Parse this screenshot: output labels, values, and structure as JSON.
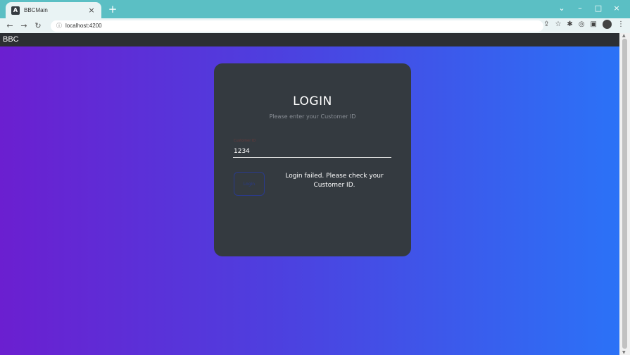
{
  "browser": {
    "tab_title": "BBCMain",
    "tab_close": "×",
    "new_tab": "+",
    "url": "localhost:4200",
    "win_minimize": "–",
    "win_maximize": "□",
    "win_close": "×",
    "chevron": "⌄"
  },
  "app": {
    "brand": "BBC"
  },
  "login": {
    "title": "LOGIN",
    "subtitle": "Please enter your Customer ID",
    "field_label": "Customer ID",
    "field_value": "1234",
    "button_label": "Login",
    "error_message": "Login failed. Please check your Customer ID."
  },
  "colors": {
    "tabstrip": "#5bbfc4",
    "header": "#2c2f33",
    "card": "#343a40",
    "gradient_start": "#6b1fd0",
    "gradient_end": "#2b72f7"
  }
}
